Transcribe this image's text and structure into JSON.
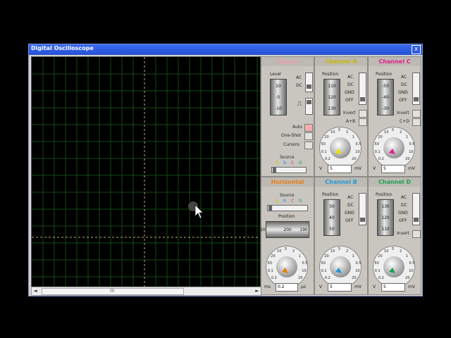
{
  "window": {
    "title": "Digital Oscilloscope",
    "close": "x"
  },
  "screen": {
    "cursor": "pointer"
  },
  "scroll": {
    "left": "◄",
    "right": "►",
    "grip": "III"
  },
  "trigger": {
    "title": "Trigger",
    "level": "Level",
    "drum": [
      "10",
      "0",
      "-10"
    ],
    "modes": [
      "AC",
      "DC"
    ],
    "options": [
      "Auto",
      "One-Shot",
      "Cursors"
    ],
    "source_label": "Source",
    "sources": [
      "A",
      "B",
      "C",
      "D"
    ]
  },
  "channelA": {
    "title": "Channel A",
    "position": "Position",
    "drum": [
      "110",
      "120",
      "130"
    ],
    "coupling": [
      "AC",
      "DC",
      "GND",
      "OFF"
    ],
    "invert": "Invert",
    "extra": "A+B",
    "readout": "5",
    "unit_left": "V",
    "unit_right": "mV"
  },
  "channelC": {
    "title": "Channel C",
    "position": "Position",
    "drum": [
      "-50",
      "-40",
      "-30"
    ],
    "coupling": [
      "AC",
      "DC",
      "GND",
      "OFF"
    ],
    "invert": "Invert",
    "extra": "C+D",
    "readout": "5",
    "unit_left": "V",
    "unit_right": "mV"
  },
  "horizontal": {
    "title": "Horizontal",
    "source_label": "Source",
    "sources": [
      "A",
      "B",
      "C",
      "D"
    ],
    "position": "Position",
    "drum": [
      "210",
      "200",
      "190"
    ],
    "readout": "0.2",
    "unit_left": "ms",
    "unit_right": "µs"
  },
  "channelB": {
    "title": "Channel B",
    "position": "Position",
    "drum": [
      "30",
      "40",
      "50"
    ],
    "coupling": [
      "AC",
      "DC",
      "GND",
      "OFF"
    ],
    "readout": "5",
    "unit_left": "V",
    "unit_right": "mV"
  },
  "channelD": {
    "title": "Channel D",
    "position": "Position",
    "drum": [
      "130",
      "120",
      "110"
    ],
    "coupling": [
      "AC",
      "DC",
      "GND",
      "OFF"
    ],
    "invert": "Invert",
    "readout": "5",
    "unit_left": "V",
    "unit_right": "mV"
  },
  "dial_ticks": [
    "0.2",
    "0.1",
    "50",
    "20",
    "10",
    "5",
    "2",
    "1",
    "0.5",
    "10",
    "20"
  ],
  "colors": {
    "trigger": "#e8a0a8",
    "channelA": "#f2e000",
    "channelB": "#1e9ad8",
    "channelC": "#e0208c",
    "channelD": "#1da050",
    "horizontal": "#e87c10"
  }
}
